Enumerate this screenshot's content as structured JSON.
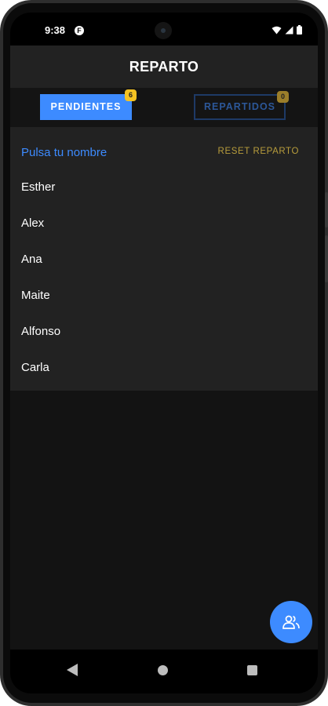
{
  "status_bar": {
    "time": "9:38",
    "notification_glyph": "F",
    "icons": [
      "wifi-icon",
      "signal-icon",
      "battery-icon"
    ]
  },
  "app_bar": {
    "title": "REPARTO"
  },
  "tabs": [
    {
      "label": "PENDIENTES",
      "badge": "6",
      "active": true
    },
    {
      "label": "REPARTIDOS",
      "badge": "0",
      "active": false
    }
  ],
  "list": {
    "prompt": "Pulsa tu nombre",
    "reset_label": "RESET REPARTO",
    "names": [
      "Esther",
      "Alex",
      "Ana",
      "Maite",
      "Alfonso",
      "Carla"
    ]
  },
  "fab": {
    "icon": "people-icon"
  },
  "nav": {
    "icons": [
      "back-icon",
      "home-icon",
      "recents-icon"
    ]
  },
  "colors": {
    "accent": "#3d8bff",
    "badge": "#f5c322",
    "reset": "#b89d3c",
    "surface": "#222222",
    "background": "#131313"
  }
}
